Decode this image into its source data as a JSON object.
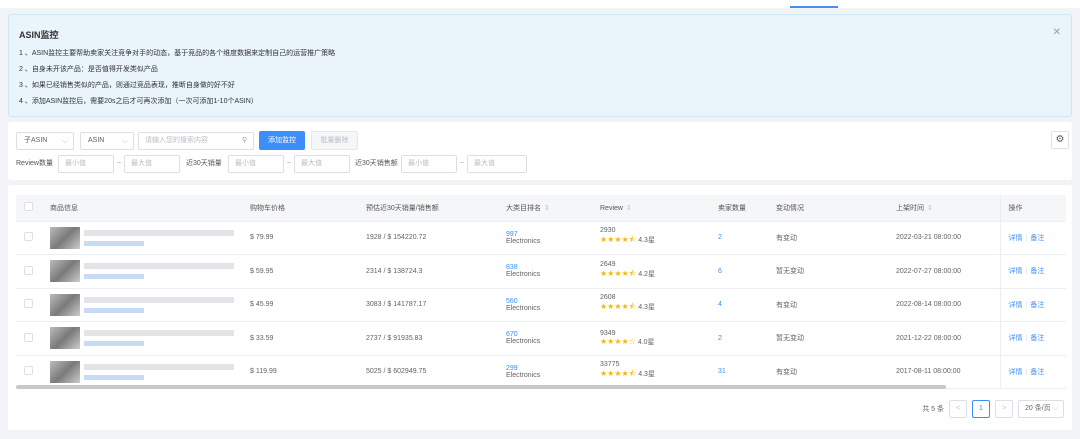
{
  "notice": {
    "title": "ASIN监控",
    "items": [
      "1 、ASIN监控主要帮助卖家关注竞争对手的动态，基于竞品的各个维度数据来定制自己的运营推广策略",
      "2 、自身未开该产品：是否值得开发类似产品",
      "3 、如果已经销售类似的产品，则通过竞品表现，推断自身做的好不好",
      "4 、添加ASIN监控后，需要20s之后才可再次添加（一次可添加1-10个ASIN）"
    ]
  },
  "filters": {
    "type_select": "子ASIN",
    "field_select": "ASIN",
    "search_placeholder": "请输入您的搜索内容",
    "add_button": "添加监控",
    "batch_delete_button": "批量删除",
    "review_label": "Review数量",
    "sales30_label": "近30天销量",
    "revenue30_label": "近30天销售额",
    "min_placeholder": "最小值",
    "max_placeholder": "最大值",
    "tilde": "~"
  },
  "table": {
    "headers": [
      "商品信息",
      "购物车价格",
      "预估近30天销量/销售额",
      "大类目排名",
      "Review",
      "卖家数量",
      "变动情况",
      "上架时间",
      "操作"
    ],
    "rows": [
      {
        "price": "$ 79.99",
        "sales": "1928 / $ 154220.72",
        "rank": "997",
        "category": "Electronics",
        "review": "2930",
        "rating": "4.3星",
        "stars": "★★★★⯪",
        "sellers": "2",
        "change": "有变动",
        "date": "2022-03-21 08:00:00"
      },
      {
        "price": "$ 59.95",
        "sales": "2314 / $ 138724.3",
        "rank": "838",
        "category": "Electronics",
        "review": "2649",
        "rating": "4.2星",
        "stars": "★★★★⯪",
        "sellers": "6",
        "change": "暂无变动",
        "date": "2022-07-27 08:00:00"
      },
      {
        "price": "$ 45.99",
        "sales": "3083 / $ 141787.17",
        "rank": "560",
        "category": "Electronics",
        "review": "2608",
        "rating": "4.3星",
        "stars": "★★★★⯪",
        "sellers": "4",
        "change": "有变动",
        "date": "2022-08-14 08:00:00"
      },
      {
        "price": "$ 33.59",
        "sales": "2737 / $ 91935.83",
        "rank": "670",
        "category": "Electronics",
        "review": "9349",
        "rating": "4.0星",
        "stars": "★★★★☆",
        "sellers": "2",
        "change": "暂无变动",
        "date": "2021-12-22 08:00:00"
      },
      {
        "price": "$ 119.99",
        "sales": "5025 / $ 602949.75",
        "rank": "299",
        "category": "Electronics",
        "review": "33775",
        "rating": "4.3星",
        "stars": "★★★★⯪",
        "sellers": "31",
        "change": "有变动",
        "date": "2017-08-11 08:00:00"
      }
    ],
    "action_detail": "详情",
    "action_note": "备注"
  },
  "pager": {
    "total": "共 5 条",
    "current": "1",
    "prev": "<",
    "next": ">",
    "size": "20 条/页"
  },
  "icons": {
    "close": "close-icon",
    "search": "search-icon",
    "settings": "gear-icon",
    "sort": "sort-icon",
    "chevron": "chevron-down-icon"
  },
  "colors": {
    "accent": "#3d8ef8",
    "star": "#f5b800",
    "notice_bg": "#e9f4fb"
  }
}
